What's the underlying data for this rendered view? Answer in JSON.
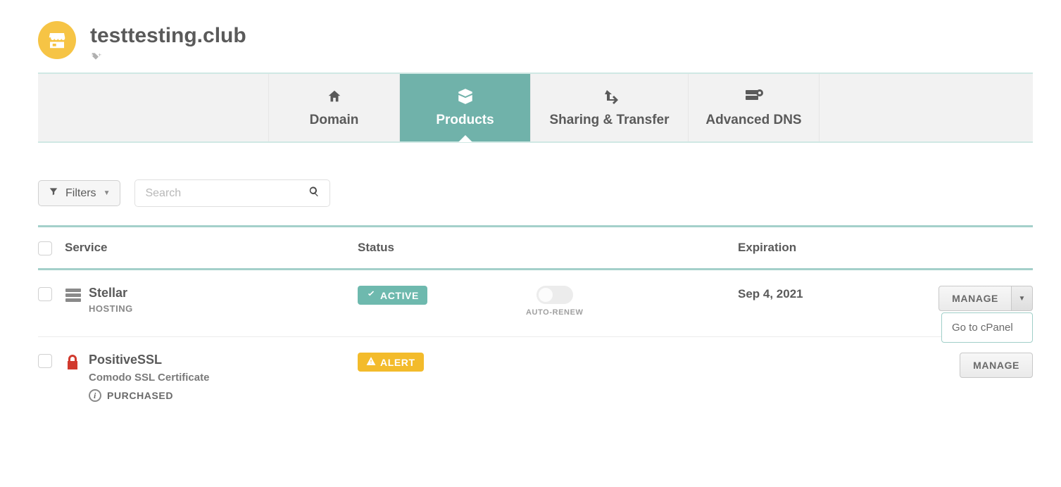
{
  "header": {
    "title": "testtesting.club"
  },
  "tabs": [
    {
      "label": "Domain"
    },
    {
      "label": "Products"
    },
    {
      "label": "Sharing & Transfer"
    },
    {
      "label": "Advanced DNS"
    }
  ],
  "controls": {
    "filters_label": "Filters",
    "search_placeholder": "Search"
  },
  "table": {
    "headers": {
      "service": "Service",
      "status": "Status",
      "expiration": "Expiration"
    },
    "rows": [
      {
        "name": "Stellar",
        "subtype": "HOSTING",
        "status_label": "ACTIVE",
        "auto_renew_label": "AUTO-RENEW",
        "expiration": "Sep 4, 2021",
        "manage_label": "MANAGE",
        "dropdown_item": "Go to cPanel"
      },
      {
        "name": "PositiveSSL",
        "description": "Comodo SSL Certificate",
        "purchased_label": "PURCHASED",
        "status_label": "ALERT",
        "manage_label": "MANAGE"
      }
    ]
  }
}
